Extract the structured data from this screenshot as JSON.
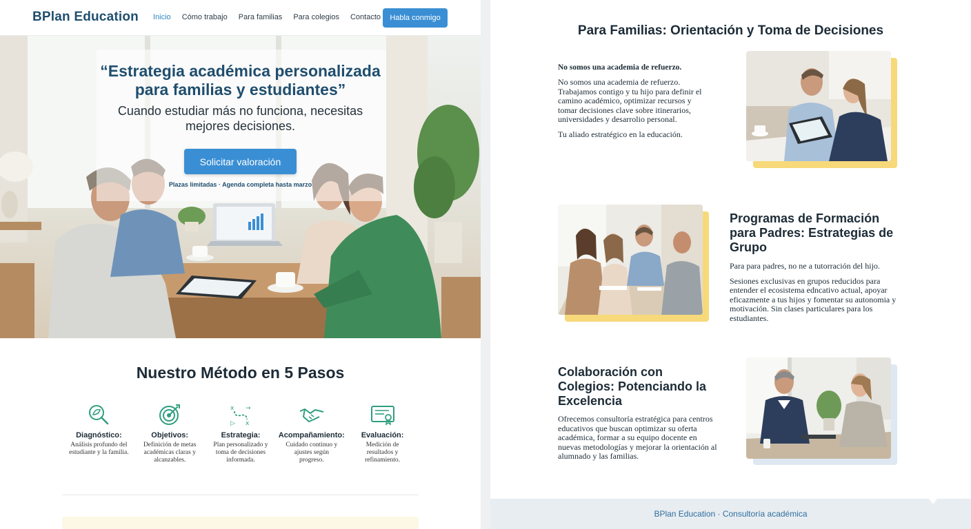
{
  "nav": {
    "brand": "BPlan Education",
    "links": [
      "Inicio",
      "Cómo trabajo",
      "Para familias",
      "Para colegios",
      "Contacto"
    ],
    "active": "Inicio",
    "cta": "Habla conmigo"
  },
  "hero": {
    "title": "“Estrategia académica personalizada para familias y estudiantes”",
    "subtitle": "Cuando estudiar más no funciona, necesitas mejores decisiones.",
    "button": "Solicitar valoración",
    "note": "Plazas limitadas · Agenda completa hasta marzo"
  },
  "method": {
    "title": "Nuestro Método en 5 Pasos",
    "steps": [
      {
        "icon": "magnifier-leaf-icon",
        "title": "Diagnóstico:",
        "desc": "Análisis profundo del estudiante y la familia."
      },
      {
        "icon": "target-icon",
        "title": "Objetivos:",
        "desc": "Definición de metas académicas claras y alcanzables."
      },
      {
        "icon": "strategy-path-icon",
        "title": "Estrategia:",
        "desc": "Plan personalizado y toma de decisiones informada."
      },
      {
        "icon": "handshake-icon",
        "title": "Acompañamiento:",
        "desc": "Cuidado continuo y ajustes según progreso."
      },
      {
        "icon": "certificate-icon",
        "title": "Evaluación:",
        "desc": "Medición de resultados y refinamiento."
      }
    ]
  },
  "right": {
    "title": "Para Familias: Orientación y Toma de Decisiones",
    "families": {
      "lead": "No somos una academia de refuerzo.",
      "body": "No somos una academia de refuerzo. Trabajamos contigo y tu hijo para definir el camino académico, optimizar recursos y tomar decisiones clave sobre itinerarios, universidades y desarrolio personal.",
      "closing": "Tu aliado estratégico en la educación."
    },
    "parents": {
      "title": "Programas de Formación para Padres: Estrategias de Grupo",
      "lead": "Para para padres, no ne a tutorración del hijo.",
      "body": "Sesiones exclusivas en grupos reducidos para entender el ecosistema edncativo actual, apoyar eficazmente a tus hijos y fomentar su autonomia y motivación. Sin clases particulares para los estudiantes."
    },
    "schools": {
      "title": "Colaboración con Colegios: Potenciando la Excelencia",
      "body": "Ofrecemos consultoría estratégica para centros educativos que buscan optimizar su oferta académica, formar a su equipo docente en nuevas metodologías y mejorar la orientación al alumnado y las familias."
    },
    "footer": "BPlan Education · Consultoría académica"
  },
  "colors": {
    "primary": "#3a8fd4",
    "brand": "#1f4e6e",
    "accent_yellow": "#f7d97a",
    "icon_green": "#2f9e7e",
    "accent_light_blue": "#dde8f2"
  }
}
